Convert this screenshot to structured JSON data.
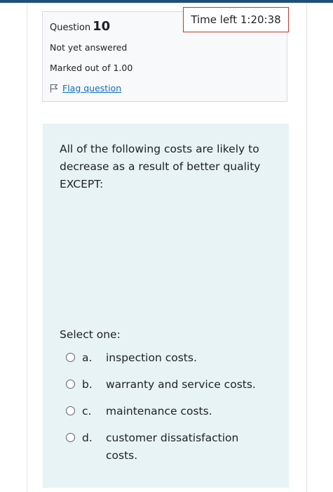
{
  "question_info": {
    "label": "Question",
    "number": "10",
    "state": "Not yet answered",
    "grade": "Marked out of 1.00",
    "flag_label": "Flag question",
    "flag_icon": "flag-outline-icon"
  },
  "timer": {
    "text": "Time left 1:20:38",
    "border_color": "#c0392b"
  },
  "question": {
    "text": "All of the following costs are likely to decrease as a result of better quality EXCEPT:",
    "prompt": "Select one:",
    "options": [
      {
        "letter": "a.",
        "text": "inspection costs."
      },
      {
        "letter": "b.",
        "text": "warranty and service costs."
      },
      {
        "letter": "c.",
        "text": "maintenance costs."
      },
      {
        "letter": "d.",
        "text": "customer dissatisfaction costs."
      }
    ]
  },
  "colors": {
    "top_bar": "#1e4f7a",
    "question_bg": "#e7f3f5",
    "info_bg": "#f8f9fa",
    "link": "#0f6cbf"
  }
}
